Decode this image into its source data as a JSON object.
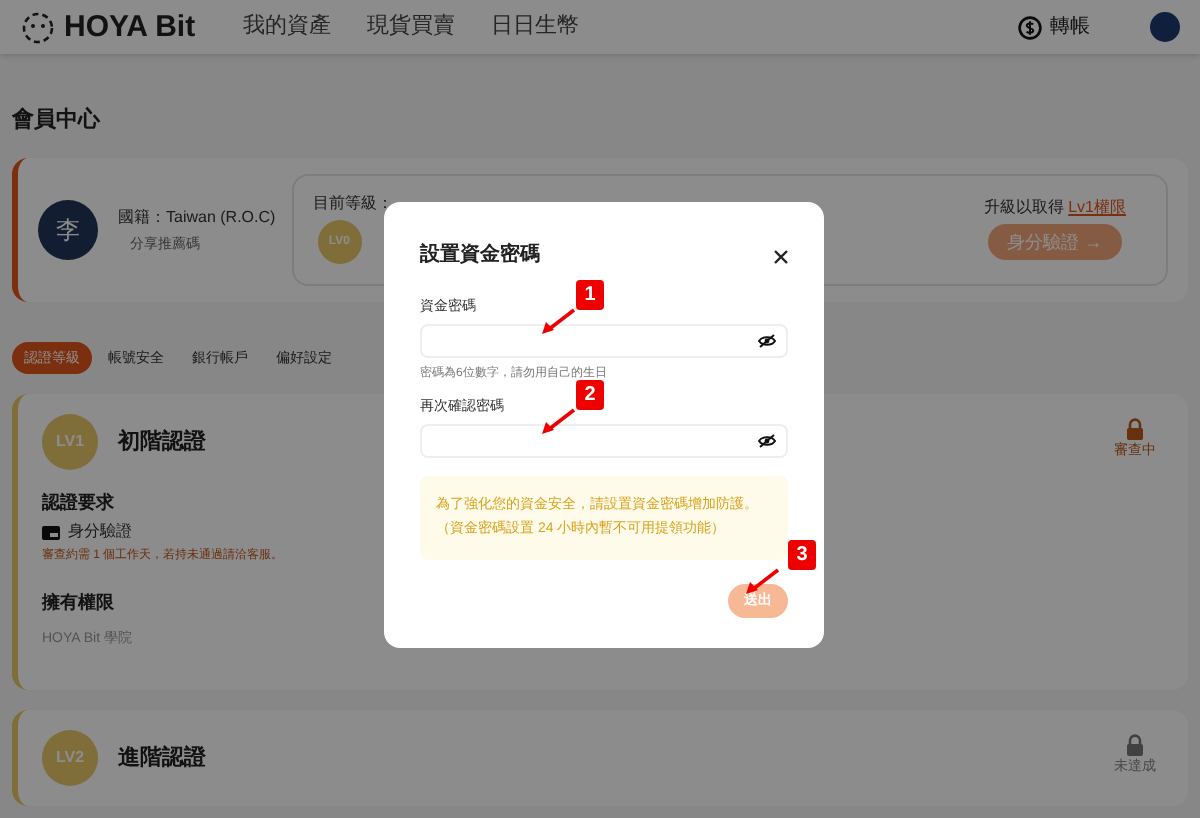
{
  "header": {
    "logo": "HOYA Bit",
    "nav": [
      {
        "label": "我的資產"
      },
      {
        "label": "現貨買賣"
      },
      {
        "label": "日日生幣"
      }
    ],
    "transfer": "轉帳"
  },
  "page_title": "會員中心",
  "profile": {
    "avatar_initial": "李",
    "nationality": "國籍：Taiwan (R.O.C)",
    "referral": "分享推薦碼",
    "level_label": "目前等級：",
    "level_badge": "LV0",
    "upgrade_text": "升級以取得",
    "upgrade_link": "Lv1權限",
    "verify_button": "身分驗證 →"
  },
  "tabs": [
    {
      "label": "認證等級",
      "selected": true
    },
    {
      "label": "帳號安全",
      "selected": false
    },
    {
      "label": "銀行帳戶",
      "selected": false
    },
    {
      "label": "偏好設定",
      "selected": false
    }
  ],
  "levels": [
    {
      "badge": "LV1",
      "title": "初階認證",
      "status": "審查中",
      "in_review": true,
      "requirement_heading": "認證要求",
      "requirement": "身分驗證",
      "note": "審查約需 1 個工作天，若持未通過請洽客服。",
      "rights_heading": "擁有權限",
      "rights": "HOYA Bit 學院"
    },
    {
      "badge": "LV2",
      "title": "進階認證",
      "status": "未達成",
      "in_review": false
    }
  ],
  "dialog": {
    "title": "設置資金密碼",
    "fields": [
      {
        "label": "資金密碼",
        "hint": "密碼為6位數字，請勿用自己的生日",
        "marker": "1"
      },
      {
        "label": "再次確認密碼",
        "marker": "2"
      }
    ],
    "notice": "為了強化您的資金安全，請設置資金密碼增加防護。（資金密碼設置 24 小時內暫不可用提領功能）",
    "submit": "送出",
    "submit_marker": "3"
  }
}
